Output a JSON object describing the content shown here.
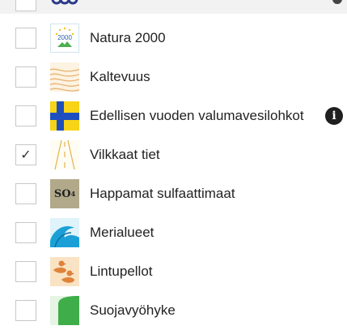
{
  "layers": [
    {
      "id": "natura",
      "label": "Natura 2000",
      "checked": false,
      "icon": "natura-2000-icon",
      "icon_text": "2000"
    },
    {
      "id": "kaltevuus",
      "label": "Kaltevuus",
      "checked": false,
      "icon": "slope-contour-icon"
    },
    {
      "id": "valuma",
      "label": "Edellisen vuoden valumavesilohkot",
      "checked": false,
      "icon": "runoff-blocks-icon",
      "info": true
    },
    {
      "id": "vilkkaat",
      "label": "Vilkkaat tiet",
      "checked": true,
      "icon": "busy-road-icon"
    },
    {
      "id": "happamat",
      "label": "Happamat sulfaattimaat",
      "checked": false,
      "icon": "sulfate-soil-icon",
      "icon_text": "SO",
      "icon_sub": "4"
    },
    {
      "id": "meri",
      "label": "Merialueet",
      "checked": false,
      "icon": "sea-wave-icon"
    },
    {
      "id": "lintu",
      "label": "Lintupellot",
      "checked": false,
      "icon": "bird-fields-icon"
    },
    {
      "id": "suoja",
      "label": "Suojavyöhyke",
      "checked": false,
      "icon": "buffer-zone-icon"
    }
  ],
  "check_mark": "✓",
  "info_glyph": "i",
  "colors": {
    "checkbox_border": "#c7c7c7",
    "so4_bg": "#b1a98a",
    "natura_blue": "#3a8fc9",
    "runoff_blue": "#1f4fbf",
    "runoff_yellow": "#f7d417",
    "sea_blue": "#1aa0d6",
    "bird_orange": "#e0833a",
    "buffer_green": "#3fae4a"
  }
}
